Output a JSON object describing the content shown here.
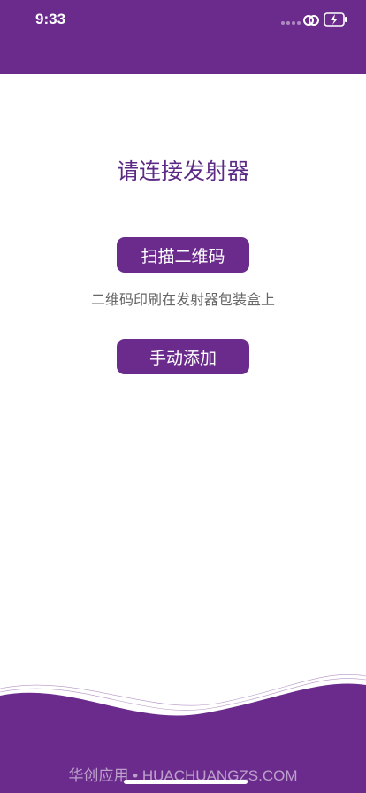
{
  "status_bar": {
    "time": "9:33",
    "icons": [
      "signal-dots-icon",
      "link-icon",
      "charging-battery-icon"
    ]
  },
  "main": {
    "title": "请连接发射器",
    "scan_button_label": "扫描二维码",
    "hint": "二维码印刷在发射器包装盒上",
    "manual_button_label": "手动添加"
  },
  "footer": {
    "watermark": "华创应用 • HUACHUANGZS.COM"
  },
  "colors": {
    "brand_purple": "#6a2b8c",
    "title_purple": "#5c2a86",
    "hint_gray": "#666666",
    "background": "#ffffff"
  }
}
